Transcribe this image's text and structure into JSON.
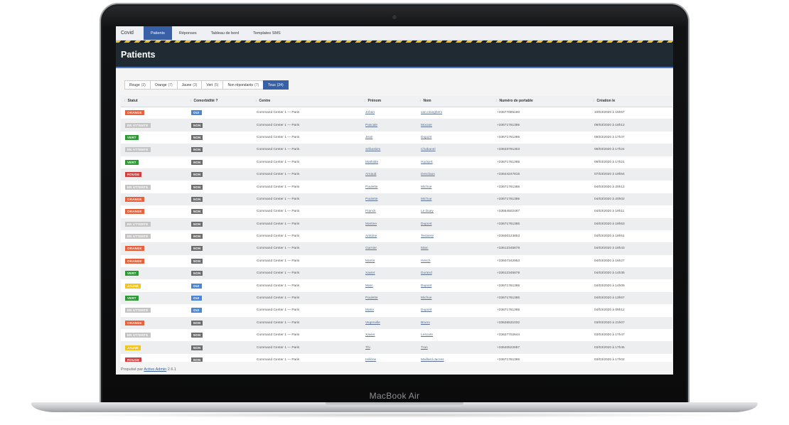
{
  "device": {
    "brand": "MacBook Air"
  },
  "nav": {
    "site_title": "Covid",
    "items": [
      {
        "label": "Patients",
        "active": true
      },
      {
        "label": "Réponses",
        "active": false
      },
      {
        "label": "Tableau de bord",
        "active": false
      },
      {
        "label": "Templates SMS",
        "active": false
      }
    ]
  },
  "page": {
    "title": "Patients"
  },
  "scopes": [
    {
      "label": "Rouge",
      "count": "(2)",
      "active": false
    },
    {
      "label": "Orange",
      "count": "(7)",
      "active": false
    },
    {
      "label": "Jaune",
      "count": "(3)",
      "active": false
    },
    {
      "label": "Vert",
      "count": "(5)",
      "active": false
    },
    {
      "label": "Non répondants",
      "count": "(7)",
      "active": false
    },
    {
      "label": "Tous",
      "count": "(24)",
      "active": true
    }
  ],
  "status_colors": {
    "ORANGE": "#e8613c",
    "EN ATTENTE": "#c4c4c4",
    "VERT": "#2e9a35",
    "ROUGE": "#d33f3f",
    "JAUNE": "#f2c41c"
  },
  "comorbidity_colors": {
    "OUI": "#4a86d8",
    "NON": "#6e6e6e"
  },
  "table": {
    "columns": [
      "Statut",
      "Comorbidité ?",
      "Centre",
      "Prénom",
      "Nom",
      "Numéro de portable",
      "Création le"
    ],
    "rows": [
      {
        "status": "ORANGE",
        "comorbidity": "OUI",
        "centre": "Command Center 1 — Paris",
        "firstname": "Johan",
        "lastname": "van nnieghem",
        "phone": "+33677885180",
        "created": "10/03/2020 à 15h57"
      },
      {
        "status": "EN ATTENTE",
        "comorbidity": "NON",
        "centre": "Command Center 1 — Paris",
        "firstname": "Pascale",
        "lastname": "Mocaer",
        "phone": "+33671761386",
        "created": "09/03/2020 à 18h12"
      },
      {
        "status": "VERT",
        "comorbidity": "NON",
        "centre": "Command Center 1 — Paris",
        "firstname": "Jean",
        "lastname": "Dupont",
        "phone": "+33671761386",
        "created": "09/03/2020 à 17h47"
      },
      {
        "status": "EN ATTENTE",
        "comorbidity": "NON",
        "centre": "Command Center 1 — Paris",
        "firstname": "Sébastien",
        "lastname": "Chabanel",
        "phone": "+33633791303",
        "created": "09/03/2020 à 17h24"
      },
      {
        "status": "VERT",
        "comorbidity": "NON",
        "centre": "Command Center 1 — Paris",
        "firstname": "Mathilde",
        "lastname": "Huckert",
        "phone": "+33671761386",
        "created": "09/03/2020 à 17h21"
      },
      {
        "status": "ROUGE",
        "comorbidity": "NON",
        "centre": "Command Center 1 — Paris",
        "firstname": "Arnaud",
        "lastname": "Desclaux",
        "phone": "+33644247815",
        "created": "07/03/2020 à 19h54"
      },
      {
        "status": "EN ATTENTE",
        "comorbidity": "NON",
        "centre": "Command Center 1 — Paris",
        "firstname": "Paulette",
        "lastname": "Michue",
        "phone": "+33671761386",
        "created": "04/03/2020 à 20h12"
      },
      {
        "status": "ORANGE",
        "comorbidity": "NON",
        "centre": "Command Center 1 — Paris",
        "firstname": "Paulette",
        "lastname": "Michue",
        "phone": "+33671761386",
        "created": "04/03/2020 à 20h02"
      },
      {
        "status": "ORANGE",
        "comorbidity": "NON",
        "centre": "Command Center 1 — Paris",
        "firstname": "Franck",
        "lastname": "Le Duey",
        "phone": "+33664502487",
        "created": "04/03/2020 à 19h11"
      },
      {
        "status": "EN ATTENTE",
        "comorbidity": "NON",
        "centre": "Command Center 1 — Paris",
        "firstname": "Martine",
        "lastname": "Dupont",
        "phone": "+33671761386",
        "created": "04/03/2020 à 18h53"
      },
      {
        "status": "EN ATTENTE",
        "comorbidity": "NON",
        "centre": "Command Center 1 — Paris",
        "firstname": "Antoine",
        "lastname": "Tesniere",
        "phone": "+33600123853",
        "created": "04/03/2020 à 18h51"
      },
      {
        "status": "ORANGE",
        "comorbidity": "NON",
        "centre": "Command Center 1 — Paris",
        "firstname": "Garnier",
        "lastname": "Marc",
        "phone": "+33612345678",
        "created": "04/03/2020 à 18h43"
      },
      {
        "status": "ORANGE",
        "comorbidity": "NON",
        "centre": "Command Center 1 — Paris",
        "firstname": "Martin",
        "lastname": "Hirsch",
        "phone": "+33607342953",
        "created": "04/03/2020 à 16h27"
      },
      {
        "status": "VERT",
        "comorbidity": "NON",
        "centre": "Command Center 1 — Paris",
        "firstname": "Xavier",
        "lastname": "Durand",
        "phone": "+33612345678",
        "created": "04/03/2020 à 14h35"
      },
      {
        "status": "JAUNE",
        "comorbidity": "OUI",
        "centre": "Command Center 1 — Paris",
        "firstname": "Marc",
        "lastname": "Dupont",
        "phone": "+33671761386",
        "created": "04/03/2020 à 14h06"
      },
      {
        "status": "VERT",
        "comorbidity": "OUI",
        "centre": "Command Center 1 — Paris",
        "firstname": "Paulette",
        "lastname": "Michue",
        "phone": "+33671761386",
        "created": "04/03/2020 à 13h57"
      },
      {
        "status": "EN ATTENTE",
        "comorbidity": "OUI",
        "centre": "Command Center 1 — Paris",
        "firstname": "Marie",
        "lastname": "Dupont",
        "phone": "+33671761386",
        "created": "04/03/2020 à 09h12"
      },
      {
        "status": "ORANGE",
        "comorbidity": "NON",
        "centre": "Command Center 1 — Paris",
        "firstname": "Vegreville",
        "lastname": "Bruno",
        "phone": "+33626531032",
        "created": "03/03/2020 à 21h07"
      },
      {
        "status": "EN ATTENTE",
        "comorbidity": "NON",
        "centre": "Command Center 1 — Paris",
        "firstname": "Xavier",
        "lastname": "Lescure",
        "phone": "+33627702644",
        "created": "03/03/2020 à 17h47"
      },
      {
        "status": "JAUNE",
        "comorbidity": "NON",
        "centre": "Command Center 1 — Paris",
        "firstname": "Thi",
        "lastname": "Tran",
        "phone": "+33640522697",
        "created": "03/03/2020 à 17h45"
      },
      {
        "status": "ROUGE",
        "comorbidity": "NON",
        "centre": "Command Center 1 — Paris",
        "firstname": "Hélène",
        "lastname": "Maillard-Jacres",
        "phone": "+33671761386",
        "created": "03/03/2020 à 17h02"
      }
    ]
  },
  "footer": {
    "prefix": "Propulsé par",
    "link": "Active Admin",
    "version": "2.6.1"
  }
}
